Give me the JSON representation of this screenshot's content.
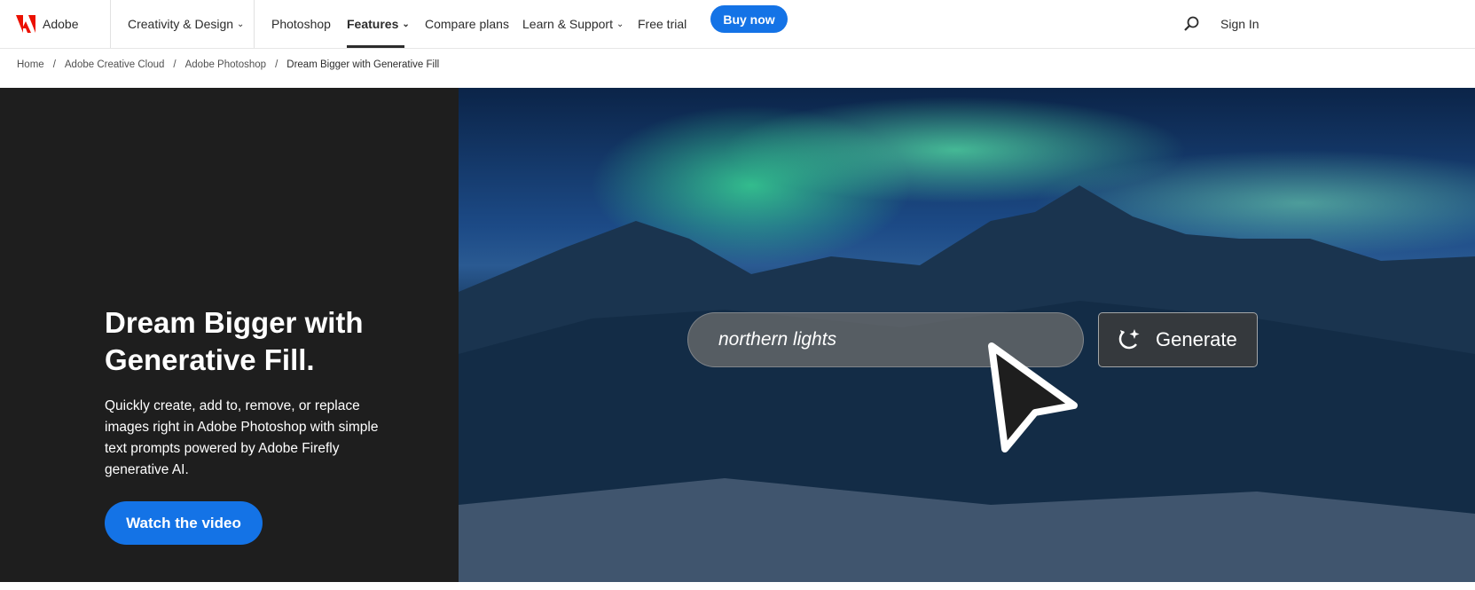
{
  "header": {
    "brand": "Adobe",
    "nav": [
      {
        "label": "Creativity & Design",
        "dropdown": true
      },
      {
        "label": "Photoshop"
      },
      {
        "label": "Features",
        "dropdown": true,
        "active": true
      },
      {
        "label": "Compare plans"
      },
      {
        "label": "Learn & Support",
        "dropdown": true
      },
      {
        "label": "Free trial"
      }
    ],
    "buy_now": "Buy now",
    "sign_in": "Sign In",
    "search_icon": "search-icon"
  },
  "breadcrumb": [
    "Home",
    "Adobe Creative Cloud",
    "Adobe Photoshop",
    "Dream Bigger with Generative Fill"
  ],
  "hero": {
    "title_line1": "Dream Bigger with",
    "title_line2": "Generative Fill.",
    "description": "Quickly create, add to, remove, or replace images right in Adobe Photoshop with simple text prompts powered by Adobe Firefly generative AI.",
    "cta": "Watch the video",
    "prompt_value": "northern lights",
    "generate_label": "Generate"
  },
  "colors": {
    "brand": "#eb1000",
    "accent": "#1473e6",
    "hero_panel": "#1e1e1e"
  }
}
